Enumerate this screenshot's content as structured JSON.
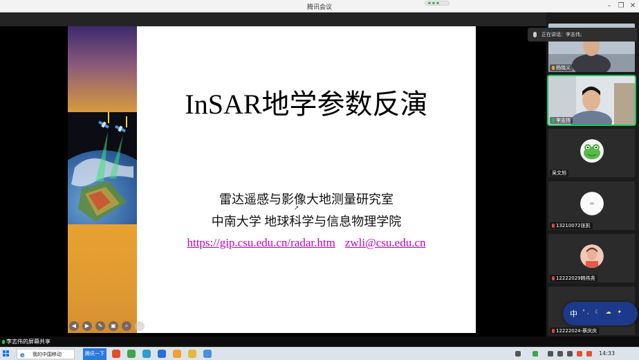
{
  "window": {
    "title": "腾讯会议",
    "minimize": "–",
    "restore": "❐",
    "close": "✕"
  },
  "slide": {
    "title": "InSAR地学参数反演",
    "line1": "雷达遥感与影像大地测量研究室",
    "line2": "中南大学 地球科学与信息物理学院",
    "link1": "https://gip.csu.edu.cn/radar.htm",
    "link2": "zwli@csu.edu.cn",
    "controls": [
      "◀",
      "▶",
      "✎",
      "▣",
      "⌕",
      "…"
    ]
  },
  "speaking_bar": {
    "text": "正在讲话：李志伟;"
  },
  "participants": [
    {
      "name": "杨晓义",
      "type": "camera"
    },
    {
      "name": "李志伟",
      "type": "camera",
      "speaking": true
    },
    {
      "name": "吴文旭",
      "type": "avatar"
    },
    {
      "name": "13210072张凯",
      "type": "avatar"
    },
    {
      "name": "12222029韩伟尧",
      "type": "avatar"
    },
    {
      "name": "12222024-蔡庆庆",
      "type": "avatar"
    }
  ],
  "ime": {
    "label": "中",
    "symbols": "°, ☾ ☁ ✦"
  },
  "share_status": {
    "text": "李志伟的屏幕共享"
  },
  "taskbar": {
    "ie_label": "我的中国移动",
    "active_label": "腾讯一下",
    "clock": "14:33"
  },
  "colors": {
    "link": "#c000c0",
    "speaking": "#19c35b",
    "ime_bg": "#1d3a8a",
    "taskbar_active": "#2a7ae0"
  }
}
